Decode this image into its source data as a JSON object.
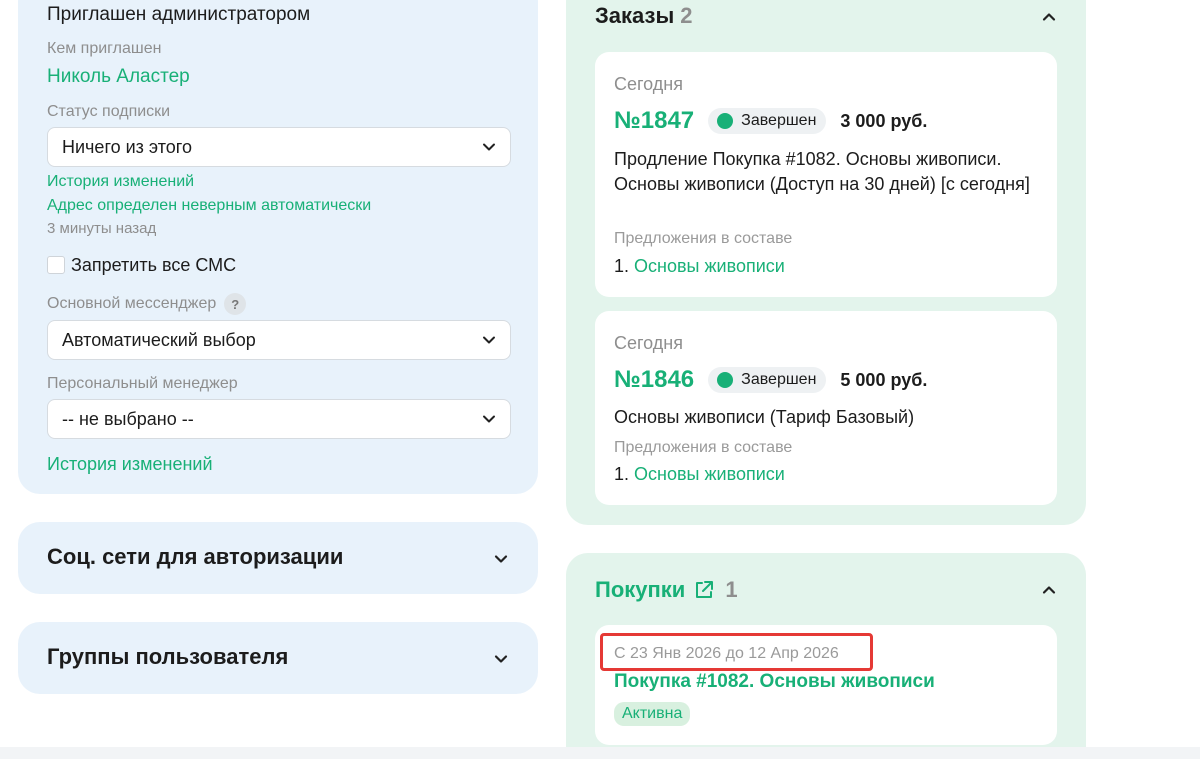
{
  "profile": {
    "invited_by_admin": "Приглашен администратором",
    "invited_by_label": "Кем приглашен",
    "invited_by_name": "Николь Аластер",
    "subscription_status_label": "Статус подписки",
    "subscription_status_value": "Ничего из этого",
    "change_history_link": "История изменений",
    "address_note_link": "Адрес определен неверным автоматически",
    "timestamp": "3 минуты назад",
    "block_sms_label": "Запретить все СМС",
    "messenger_label": "Основной мессенджер",
    "messenger_help": "?",
    "messenger_value": "Автоматический выбор",
    "manager_label": "Персональный менеджер",
    "manager_value": "-- не выбрано --",
    "change_history_link_2": "История изменений"
  },
  "accordions": {
    "social": "Соц. сети для авторизации",
    "groups": "Группы пользователя"
  },
  "orders": {
    "title": "Заказы",
    "count": "2",
    "items": [
      {
        "date": "Сегодня",
        "number": "№1847",
        "status": "Завершен",
        "price": "3 000 руб.",
        "description": "Продление Покупка #1082. Основы живописи. Основы живописи (Доступ на 30 дней) [с сегодня]",
        "offers_label": "Предложения в составе",
        "offer_index": "1.",
        "offer_name": "Основы живописи"
      },
      {
        "date": "Сегодня",
        "number": "№1846",
        "status": "Завершен",
        "price": "5 000 руб.",
        "description": "Основы живописи (Тариф Базовый)",
        "offers_label": "Предложения в составе",
        "offer_index": "1.",
        "offer_name": "Основы живописи"
      }
    ]
  },
  "purchases": {
    "title": "Покупки",
    "count": "1",
    "items": [
      {
        "period": "С 23 Янв 2026 до 12 Апр 2026",
        "name": "Покупка #1082. Основы живописи",
        "status": "Активна"
      }
    ]
  },
  "colors": {
    "accent": "#18b077",
    "left_panel_bg": "#e8f2fb",
    "right_panel_bg": "#e3f4ec",
    "highlight": "#e53935"
  }
}
